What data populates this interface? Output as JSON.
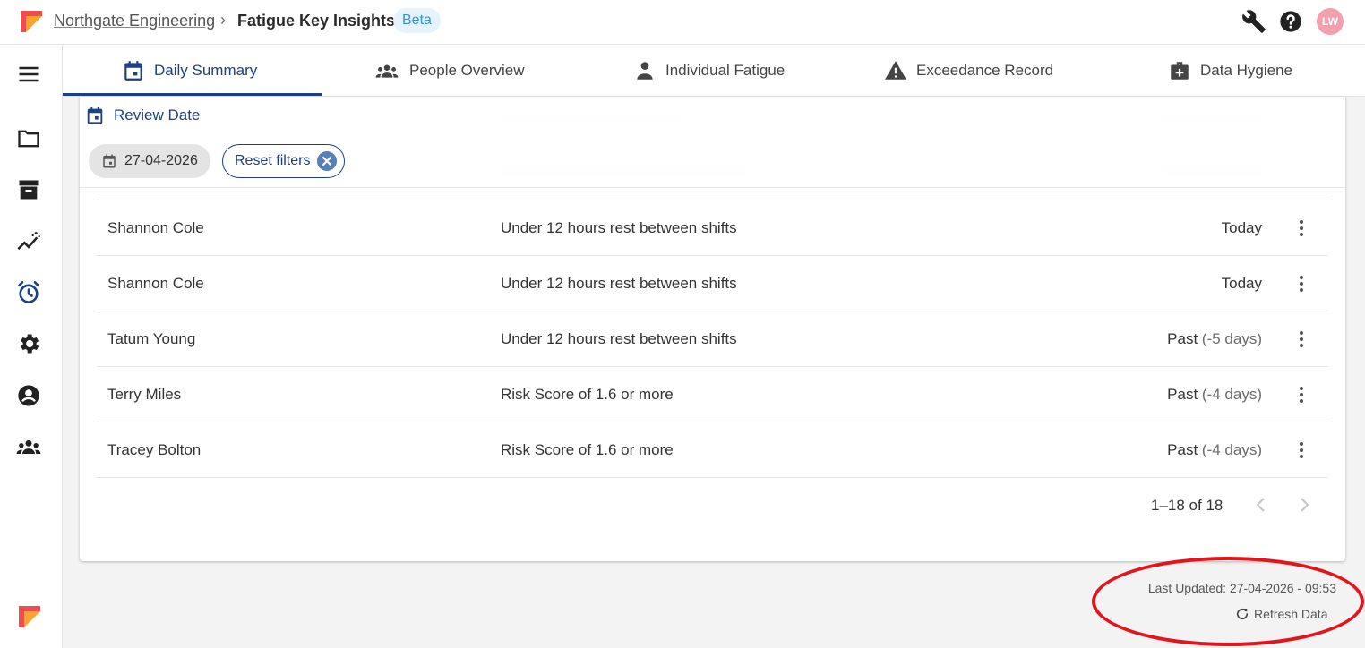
{
  "header": {
    "org_link": "Northgate Engineering",
    "separator": "›",
    "page_title": "Fatigue Key Insights",
    "badge": "Beta",
    "icons": [
      "wrench-icon",
      "help-icon"
    ],
    "avatar_initials": "LW"
  },
  "sidebar": {
    "icons": [
      "menu-icon",
      "folder-icon",
      "archive-icon",
      "trend-icon",
      "alarm-icon",
      "settings-icon",
      "account-icon",
      "groups-icon"
    ]
  },
  "tabs": [
    {
      "label": "Daily Summary",
      "icon": "calendar-icon",
      "active": true
    },
    {
      "label": "People Overview",
      "icon": "people-icon",
      "active": false
    },
    {
      "label": "Individual Fatigue",
      "icon": "person-icon",
      "active": false
    },
    {
      "label": "Exceedance Record",
      "icon": "warning-icon",
      "active": false
    },
    {
      "label": "Data Hygiene",
      "icon": "medical-bag-icon",
      "active": false
    }
  ],
  "filters": {
    "heading": "Review Date",
    "date_chip": "27-04-2026",
    "reset_label": "Reset filters"
  },
  "table": {
    "rows": [
      {
        "name": "Shannon Cole",
        "reason": "Under 12 hours rest between shifts",
        "when": "Today",
        "when_detail": ""
      },
      {
        "name": "Shannon Cole",
        "reason": "Under 12 hours rest between shifts",
        "when": "Today",
        "when_detail": ""
      },
      {
        "name": "Tatum Young",
        "reason": "Under 12 hours rest between shifts",
        "when": "Past",
        "when_detail": "(-5 days)"
      },
      {
        "name": "Terry Miles",
        "reason": "Risk Score of 1.6 or more",
        "when": "Past",
        "when_detail": "(-4 days)"
      },
      {
        "name": "Tracey Bolton",
        "reason": "Risk Score of 1.6 or more",
        "when": "Past",
        "when_detail": "(-4 days)"
      }
    ],
    "pagination": "1–18 of 18"
  },
  "footer": {
    "last_updated": "Last Updated: 27-04-2026 - 09:53",
    "refresh_label": "Refresh Data"
  },
  "colors": {
    "primary": "#1c3f86",
    "badge_bg": "#e6f3fc",
    "badge_text": "#2f95dc",
    "avatar_bg": "#f2a0ad",
    "annotation": "#e3141b"
  }
}
